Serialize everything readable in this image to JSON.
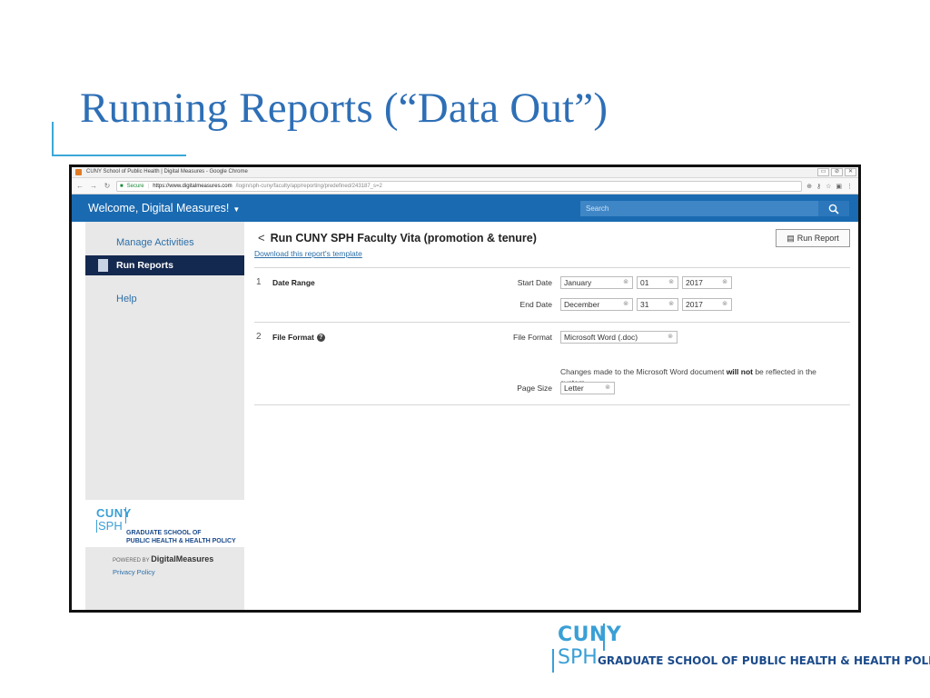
{
  "slide": {
    "title": "Running Reports (“Data Out”)"
  },
  "browser": {
    "window_title": "CUNY School of Public Health | Digital Measures - Google Chrome",
    "secure_label": "Secure",
    "url_main": "https://www.digitalmeasures.com",
    "url_rest": "/login/sph-cuny/faculty/app/reporting/predefined/243187_s=2",
    "controls": [
      "▭",
      "⊘",
      "✕"
    ]
  },
  "header": {
    "welcome": "Welcome, Digital Measures!",
    "search_placeholder": "Search"
  },
  "sidebar": {
    "items": [
      {
        "label": "Manage Activities"
      },
      {
        "label": "Run Reports"
      },
      {
        "label": "Help"
      }
    ],
    "logo_cuny": "CUNY",
    "logo_sph": "SPH",
    "logo_text_1": "GRADUATE SCHOOL OF",
    "logo_text_2": "PUBLIC HEALTH & HEALTH POLICY",
    "powered_by": "POWERED BY",
    "powered_brand": "DigitalMeasures",
    "privacy_policy": "Privacy Policy"
  },
  "report": {
    "title": "Run CUNY SPH Faculty Vita (promotion & tenure)",
    "template_link": "Download this report's template",
    "run_button": "Run Report",
    "sections": [
      {
        "number": "1",
        "label": "Date Range"
      },
      {
        "number": "2",
        "label": "File Format"
      }
    ],
    "start_date_label": "Start Date",
    "start_month": "January",
    "start_day": "01",
    "start_year": "2017",
    "end_date_label": "End Date",
    "end_month": "December",
    "end_day": "31",
    "end_year": "2017",
    "file_format_label": "File Format",
    "file_format_value": "Microsoft Word (.doc)",
    "note_before": "Changes made to the Microsoft Word document ",
    "note_bold": "will not",
    "note_after": " be reflected in the system.",
    "page_size_label": "Page Size",
    "page_size_value": "Letter"
  },
  "footer_logo": {
    "cuny": "CUNY",
    "sph": "SPH",
    "text": "GRADUATE SCHOOL OF PUBLIC HEALTH & HEALTH POLICY"
  },
  "colors": {
    "title_blue": "#2e6fb6",
    "header_blue": "#1a6ab1",
    "nav_active": "#14294f",
    "accent_cyan": "#3a9fd6"
  }
}
